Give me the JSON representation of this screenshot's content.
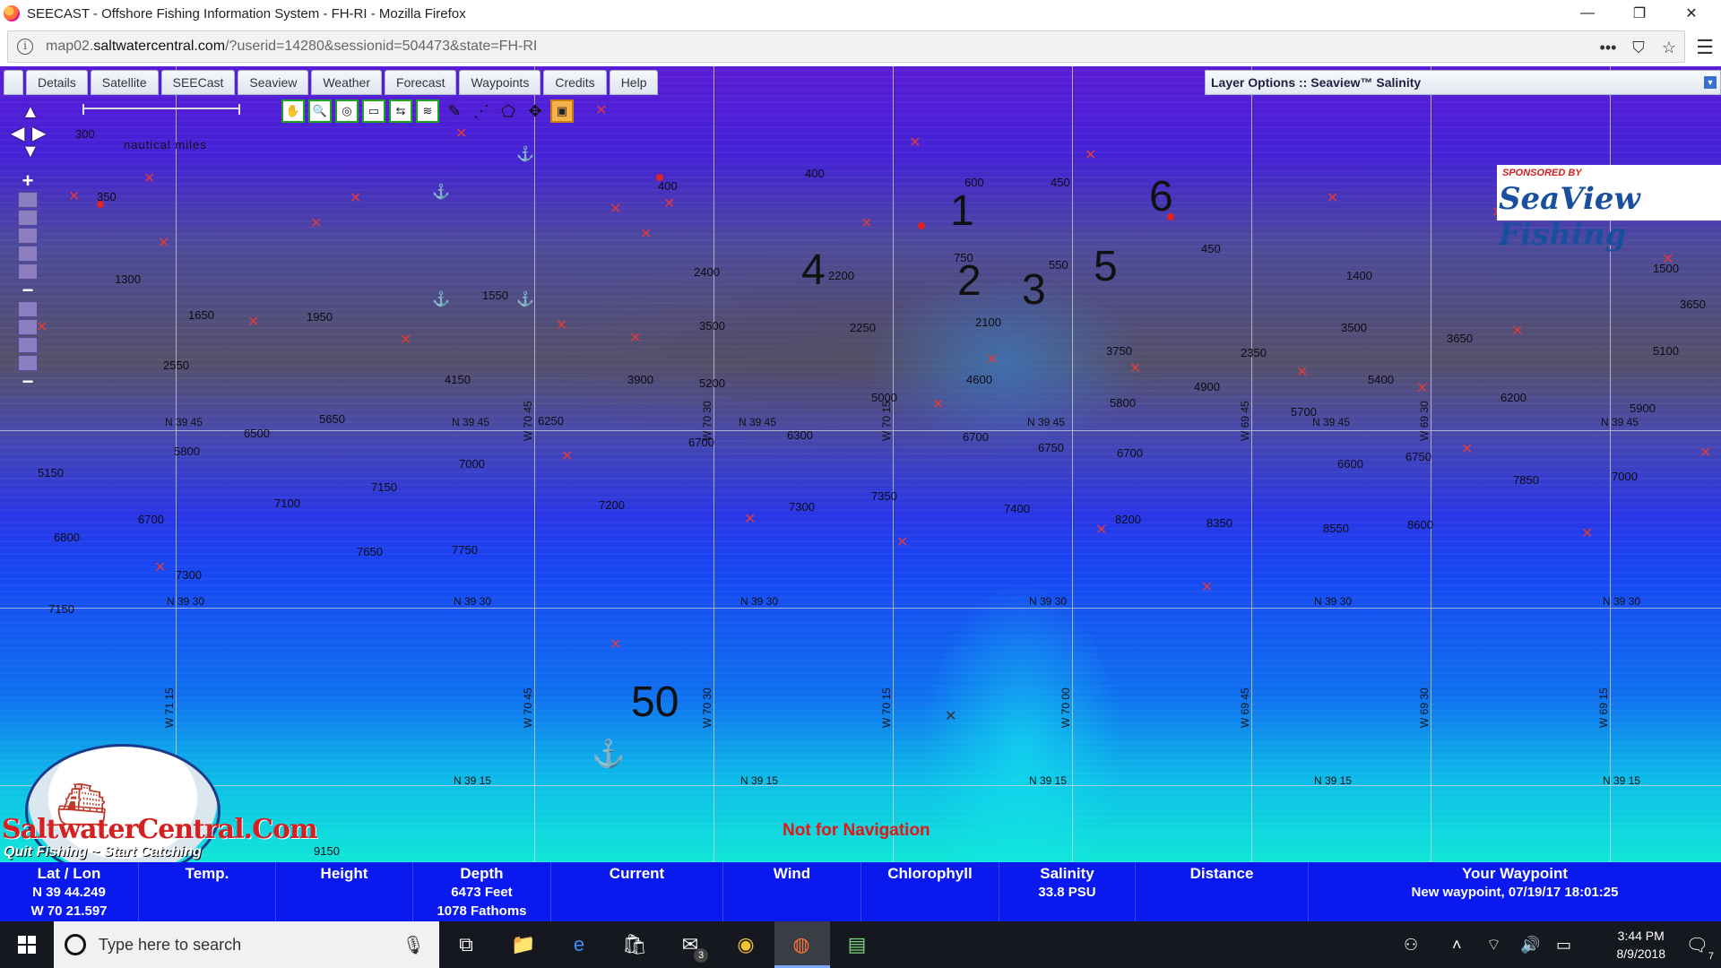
{
  "window": {
    "title": "SEECAST - Offshore Fishing Information System - FH-RI - Mozilla Firefox",
    "minimize": "—",
    "restore": "❐",
    "close": "✕"
  },
  "urlbar": {
    "url_prefix": "map02.",
    "url_domain": "saltwatercentral.com",
    "url_rest": "/?userid=14280&sessionid=504473&state=FH-RI",
    "info_icon": "i",
    "more_icon": "•••",
    "pocket_icon": "⛉",
    "star_icon": "☆",
    "menu_icon": "☰"
  },
  "tabs": [
    "Details",
    "Satellite",
    "SEECast",
    "Seaview",
    "Weather",
    "Forecast",
    "Waypoints",
    "Credits",
    "Help"
  ],
  "layer_panel": {
    "label": "Layer Options :: Seaview™ Salinity",
    "dropdown": "▼"
  },
  "toolbar_icons": [
    "pan-hand-icon",
    "zoom-icon",
    "globe-icon",
    "nm-icon",
    "refresh-icon",
    "layers-icon",
    "pen-icon",
    "dotted-line-icon",
    "polygon-icon",
    "move-icon",
    "all-icon"
  ],
  "map": {
    "scale_label": "nautical miles",
    "scale_ticks": [
      "0",
      "6.21",
      "12"
    ],
    "zoom_in": "+",
    "zoom_out": "−",
    "grid_h": [
      {
        "label": "N 39 45",
        "y": 0
      },
      {
        "label": "N 39 30",
        "y": 0
      },
      {
        "label": "N 39 15",
        "y": 0
      }
    ],
    "grid_v": [
      {
        "label": "W 71 15"
      },
      {
        "label": "W 70 45"
      },
      {
        "label": "W 70 30"
      },
      {
        "label": "W 70 15"
      },
      {
        "label": "W 70 00"
      },
      {
        "label": "W 69 45"
      },
      {
        "label": "W 69 30"
      },
      {
        "label": "W 69 15"
      }
    ],
    "depths": [
      {
        "t": "300"
      },
      {
        "t": "350"
      },
      {
        "t": "1300"
      },
      {
        "t": "1650"
      },
      {
        "t": "1950"
      },
      {
        "t": "1550"
      },
      {
        "t": "2550"
      },
      {
        "t": "4150"
      },
      {
        "t": "5650"
      },
      {
        "t": "6500"
      },
      {
        "t": "5800"
      },
      {
        "t": "5150"
      },
      {
        "t": "6700"
      },
      {
        "t": "6800"
      },
      {
        "t": "7100"
      },
      {
        "t": "7150"
      },
      {
        "t": "7650"
      },
      {
        "t": "7750"
      },
      {
        "t": "7300"
      },
      {
        "t": "7150"
      },
      {
        "t": "7000"
      },
      {
        "t": "6250"
      },
      {
        "t": "3900"
      },
      {
        "t": "2400"
      },
      {
        "t": "3500"
      },
      {
        "t": "5200"
      },
      {
        "t": "6700"
      },
      {
        "t": "6300"
      },
      {
        "t": "7200"
      },
      {
        "t": "7300"
      },
      {
        "t": "7350"
      },
      {
        "t": "2250"
      },
      {
        "t": "400"
      },
      {
        "t": "400"
      },
      {
        "t": "2200"
      },
      {
        "t": "600"
      },
      {
        "t": "750"
      },
      {
        "t": "2100"
      },
      {
        "t": "4600"
      },
      {
        "t": "5000"
      },
      {
        "t": "6700"
      },
      {
        "t": "6750"
      },
      {
        "t": "7400"
      },
      {
        "t": "450"
      },
      {
        "t": "550"
      },
      {
        "t": "3750"
      },
      {
        "t": "5800"
      },
      {
        "t": "6700"
      },
      {
        "t": "8200"
      },
      {
        "t": "4900"
      },
      {
        "t": "8350"
      },
      {
        "t": "450"
      },
      {
        "t": "2350"
      },
      {
        "t": "5700"
      },
      {
        "t": "1400"
      },
      {
        "t": "3500"
      },
      {
        "t": "5400"
      },
      {
        "t": "6600"
      },
      {
        "t": "8550"
      },
      {
        "t": "3650"
      },
      {
        "t": "6750"
      },
      {
        "t": "8600"
      },
      {
        "t": "6200"
      },
      {
        "t": "7850"
      },
      {
        "t": "550"
      },
      {
        "t": "1500"
      },
      {
        "t": "3650"
      },
      {
        "t": "5100"
      },
      {
        "t": "5900"
      },
      {
        "t": "7000"
      },
      {
        "t": "9150"
      }
    ],
    "big_numbers": [
      "1",
      "2",
      "3",
      "4",
      "5",
      "6",
      "50"
    ],
    "not_for_navigation": "Not for Navigation"
  },
  "sponsor": {
    "line1": "SPONSORED BY",
    "line2": "SeaView Fishing"
  },
  "logo": {
    "name": "SaltwaterCentral.Com",
    "tagline": "Quit Fishing ~ Start Catching"
  },
  "infobar": {
    "latlon": {
      "label": "Lat / Lon",
      "lat": "N 39 44.249",
      "lon": "W 70 21.597"
    },
    "temp": {
      "label": "Temp."
    },
    "height": {
      "label": "Height"
    },
    "depth": {
      "label": "Depth",
      "feet": "6473 Feet",
      "fathoms": "1078 Fathoms"
    },
    "current": {
      "label": "Current"
    },
    "wind": {
      "label": "Wind"
    },
    "chlorophyll": {
      "label": "Chlorophyll"
    },
    "salinity": {
      "label": "Salinity",
      "value": "33.8 PSU"
    },
    "distance": {
      "label": "Distance"
    },
    "waypoint": {
      "label": "Your Waypoint",
      "value": "New waypoint, 07/19/17 18:01:25"
    }
  },
  "taskbar": {
    "search_placeholder": "Type here to search",
    "time": "3:44 PM",
    "date": "8/9/2018",
    "mail_badge": "3",
    "notif_badge": "7"
  },
  "colors": {
    "infobar": "#0a1aef",
    "taskbar": "#15181e",
    "nfn": "#e01818"
  }
}
